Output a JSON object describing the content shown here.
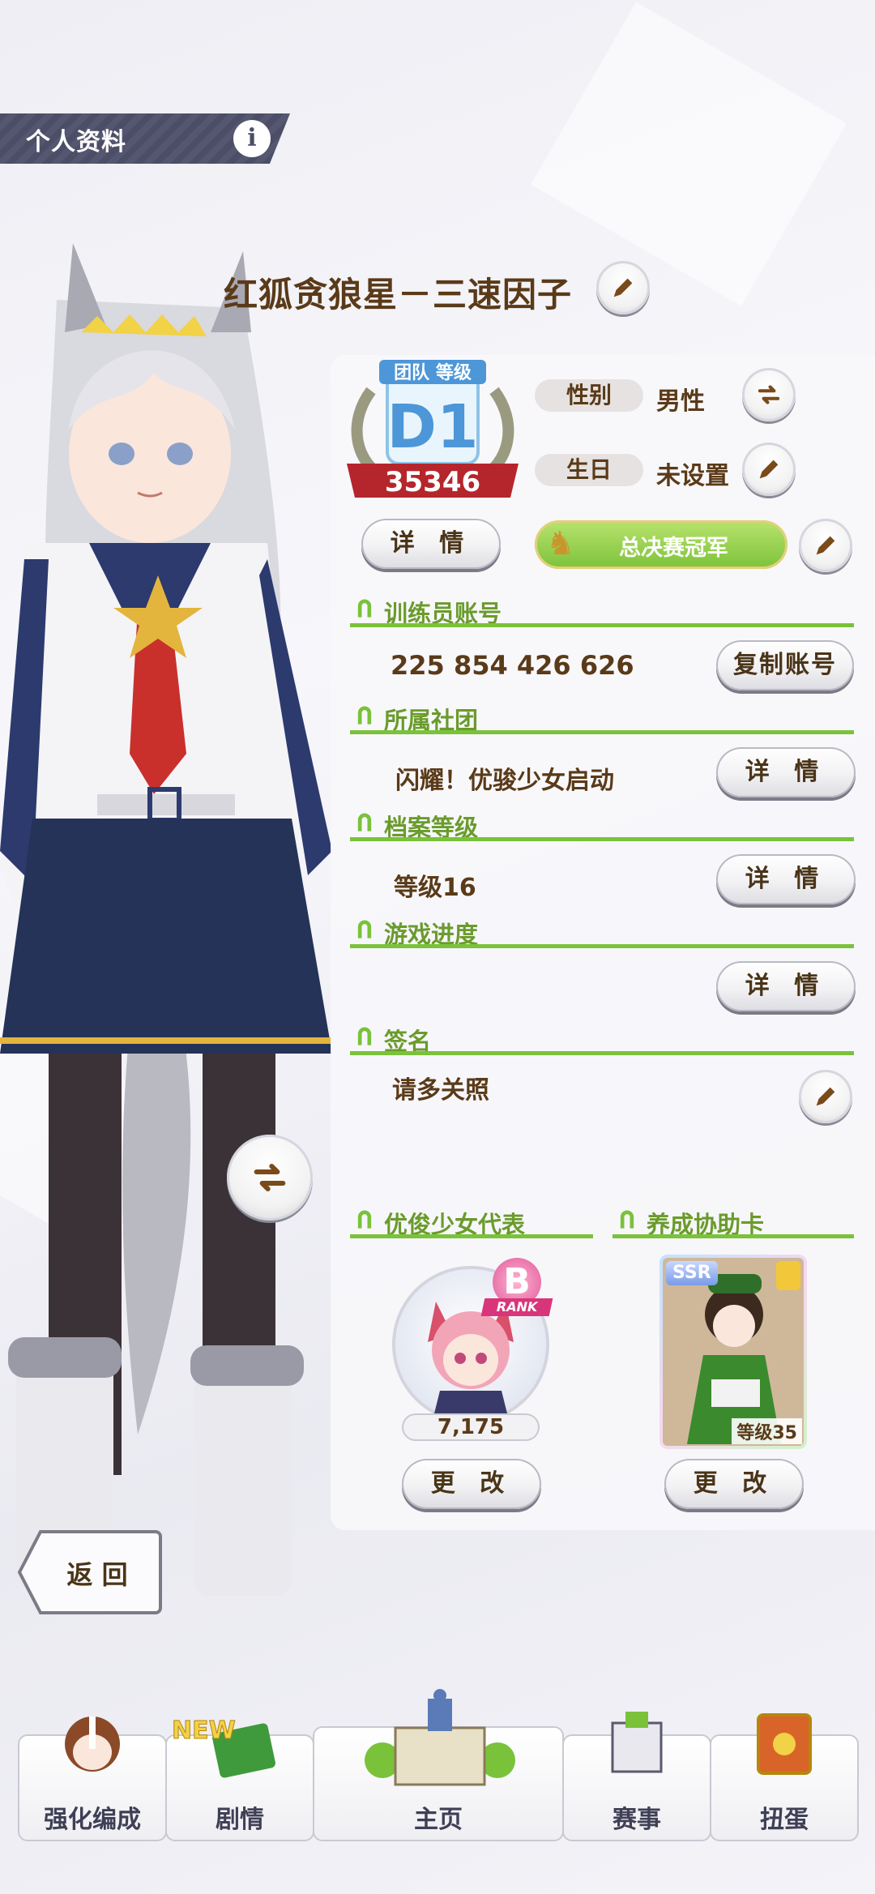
{
  "header": {
    "title": "个人资料",
    "info_glyph": "i"
  },
  "profile": {
    "name": "红狐贪狼星－三速因子",
    "team_rank": {
      "caption": "团队 等级",
      "grade": "D1",
      "score": "35346"
    },
    "gender_label": "性别",
    "gender_value": "男性",
    "birthday_label": "生日",
    "birthday_value": "未设置",
    "rank_detail_button": "详 情",
    "title_badge": "总决赛冠军"
  },
  "sections": {
    "trainer_id": {
      "title": "训练员账号",
      "value": "225 854 426 626",
      "button": "复制账号"
    },
    "club": {
      "title": "所属社团",
      "value": "闪耀！优骏少女启动",
      "button": "详 情"
    },
    "file_level": {
      "title": "档案等级",
      "value": "等级16",
      "button": "详 情"
    },
    "progress": {
      "title": "游戏进度",
      "button": "详 情"
    },
    "signature": {
      "title": "签名",
      "value": "请多关照"
    },
    "representative": {
      "title": "优俊少女代表",
      "rank": "B",
      "rank_word": "RANK",
      "score": "7,175",
      "button": "更 改"
    },
    "support_card": {
      "title": "养成协助卡",
      "rarity": "SSR",
      "level": "等级35",
      "button": "更 改"
    }
  },
  "back_button": "返 回",
  "nav": [
    {
      "label": "强化编成"
    },
    {
      "label": "剧情",
      "badge": "NEW"
    },
    {
      "label": "主页"
    },
    {
      "label": "赛事"
    },
    {
      "label": "扭蛋"
    }
  ],
  "colors": {
    "accent_green": "#7ac23a",
    "text_brown": "#5a3a18",
    "header_bg": "#4c4d66"
  }
}
